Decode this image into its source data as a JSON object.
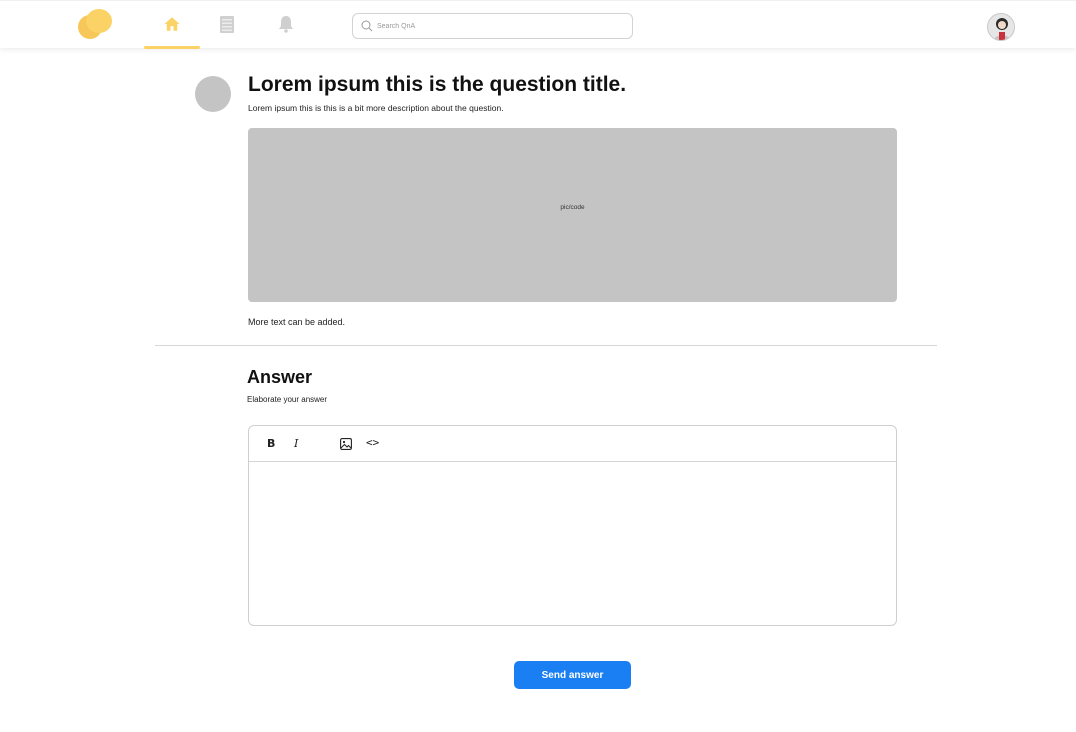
{
  "brand": {
    "accent": "#fbd266",
    "primary_button": "#1a7ff2"
  },
  "nav": {
    "items": [
      {
        "icon": "home-icon",
        "active": true
      },
      {
        "icon": "document-icon",
        "active": false
      },
      {
        "icon": "bell-icon",
        "active": false
      }
    ],
    "search": {
      "placeholder": "Search QnA"
    },
    "user_avatar_icon": "user-avatar-icon"
  },
  "question": {
    "title": "Lorem ipsum this is the question title.",
    "description": "Lorem ipsum this is this is a bit more description about the question.",
    "media_placeholder": "pic/code",
    "extra_text": "More text can be added."
  },
  "answer": {
    "heading": "Answer",
    "subheading": "Elaborate your answer",
    "toolbar": {
      "bold": "B",
      "italic": "I",
      "image_icon": "image-icon",
      "code": "<>"
    },
    "value": ""
  },
  "actions": {
    "send_label": "Send answer"
  }
}
